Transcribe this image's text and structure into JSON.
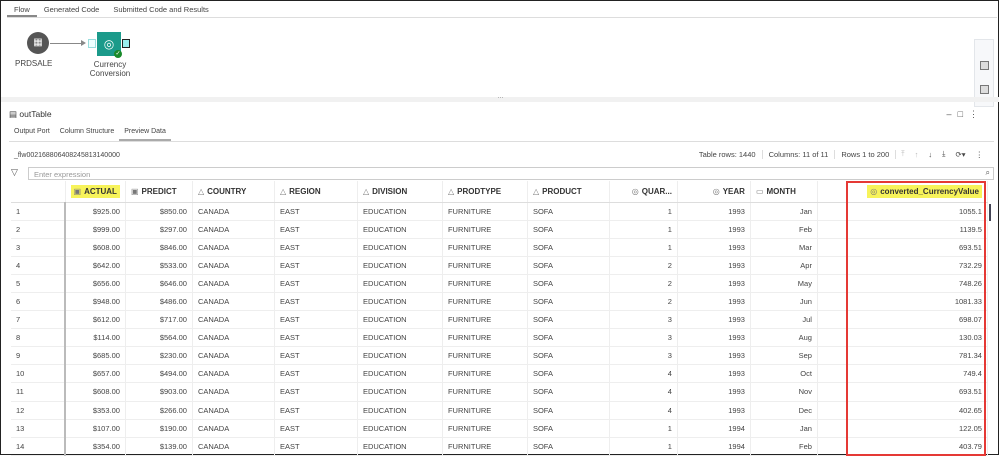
{
  "tabs": [
    "Flow",
    "Generated Code",
    "Submitted Code and Results"
  ],
  "flow": {
    "source_node": "PRDSALE",
    "transform_node": "Currency Conversion"
  },
  "output": {
    "title": "outTable",
    "subtabs": [
      "Output Port",
      "Column Structure",
      "Preview Data"
    ],
    "table_name": "_flw00216880640824581314000​0",
    "table_rows": "Table rows: 1440",
    "columns": "Columns: 11 of 11",
    "rows_range": "Rows 1 to 200",
    "filter_placeholder": "Enter expression"
  },
  "columns": [
    "ACTUAL",
    "PREDICT",
    "COUNTRY",
    "REGION",
    "DIVISION",
    "PRODTYPE",
    "PRODUCT",
    "QUAR...",
    "YEAR",
    "MONTH",
    "converted_CurrencyValue"
  ],
  "rows": [
    [
      "1",
      "$925.00",
      "$850.00",
      "CANADA",
      "EAST",
      "EDUCATION",
      "FURNITURE",
      "SOFA",
      "1",
      "1993",
      "Jan",
      "1055.1"
    ],
    [
      "2",
      "$999.00",
      "$297.00",
      "CANADA",
      "EAST",
      "EDUCATION",
      "FURNITURE",
      "SOFA",
      "1",
      "1993",
      "Feb",
      "1139.5"
    ],
    [
      "3",
      "$608.00",
      "$846.00",
      "CANADA",
      "EAST",
      "EDUCATION",
      "FURNITURE",
      "SOFA",
      "1",
      "1993",
      "Mar",
      "693.51"
    ],
    [
      "4",
      "$642.00",
      "$533.00",
      "CANADA",
      "EAST",
      "EDUCATION",
      "FURNITURE",
      "SOFA",
      "2",
      "1993",
      "Apr",
      "732.29"
    ],
    [
      "5",
      "$656.00",
      "$646.00",
      "CANADA",
      "EAST",
      "EDUCATION",
      "FURNITURE",
      "SOFA",
      "2",
      "1993",
      "May",
      "748.26"
    ],
    [
      "6",
      "$948.00",
      "$486.00",
      "CANADA",
      "EAST",
      "EDUCATION",
      "FURNITURE",
      "SOFA",
      "2",
      "1993",
      "Jun",
      "1081.33"
    ],
    [
      "7",
      "$612.00",
      "$717.00",
      "CANADA",
      "EAST",
      "EDUCATION",
      "FURNITURE",
      "SOFA",
      "3",
      "1993",
      "Jul",
      "698.07"
    ],
    [
      "8",
      "$114.00",
      "$564.00",
      "CANADA",
      "EAST",
      "EDUCATION",
      "FURNITURE",
      "SOFA",
      "3",
      "1993",
      "Aug",
      "130.03"
    ],
    [
      "9",
      "$685.00",
      "$230.00",
      "CANADA",
      "EAST",
      "EDUCATION",
      "FURNITURE",
      "SOFA",
      "3",
      "1993",
      "Sep",
      "781.34"
    ],
    [
      "10",
      "$657.00",
      "$494.00",
      "CANADA",
      "EAST",
      "EDUCATION",
      "FURNITURE",
      "SOFA",
      "4",
      "1993",
      "Oct",
      "749.4"
    ],
    [
      "11",
      "$608.00",
      "$903.00",
      "CANADA",
      "EAST",
      "EDUCATION",
      "FURNITURE",
      "SOFA",
      "4",
      "1993",
      "Nov",
      "693.51"
    ],
    [
      "12",
      "$353.00",
      "$266.00",
      "CANADA",
      "EAST",
      "EDUCATION",
      "FURNITURE",
      "SOFA",
      "4",
      "1993",
      "Dec",
      "402.65"
    ],
    [
      "13",
      "$107.00",
      "$190.00",
      "CANADA",
      "EAST",
      "EDUCATION",
      "FURNITURE",
      "SOFA",
      "1",
      "1994",
      "Jan",
      "122.05"
    ],
    [
      "14",
      "$354.00",
      "$139.00",
      "CANADA",
      "EAST",
      "EDUCATION",
      "FURNITURE",
      "SOFA",
      "1",
      "1994",
      "Feb",
      "403.79"
    ]
  ],
  "colors": {
    "highlight": "#f7f35a",
    "node": "#1b9a8a",
    "annotation": "#e53935"
  }
}
